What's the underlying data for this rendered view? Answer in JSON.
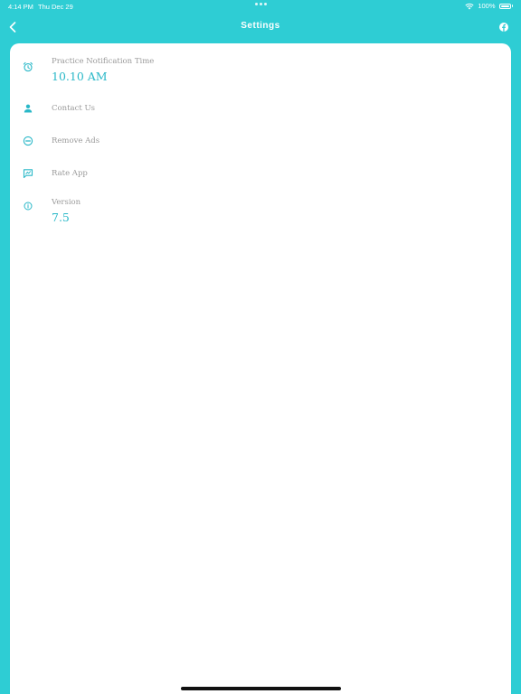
{
  "status_bar": {
    "time": "4:14 PM",
    "date": "Thu Dec 29",
    "battery": "100%"
  },
  "nav": {
    "title": "Settings",
    "back_icon": "chevron-left-icon",
    "right_icon": "facebook-icon"
  },
  "colors": {
    "accent": "#2ecdd4",
    "value_text": "#2ab8c8",
    "label_text": "#9a9a9a"
  },
  "settings": [
    {
      "icon": "alarm-clock-icon",
      "label": "Practice Notification Time",
      "value": "10.10 AM"
    },
    {
      "icon": "person-icon",
      "label": "Contact Us"
    },
    {
      "icon": "minus-circle-icon",
      "label": "Remove Ads"
    },
    {
      "icon": "rate-app-icon",
      "label": "Rate App"
    },
    {
      "icon": "info-circle-icon",
      "label": "Version",
      "value": "7.5"
    }
  ]
}
